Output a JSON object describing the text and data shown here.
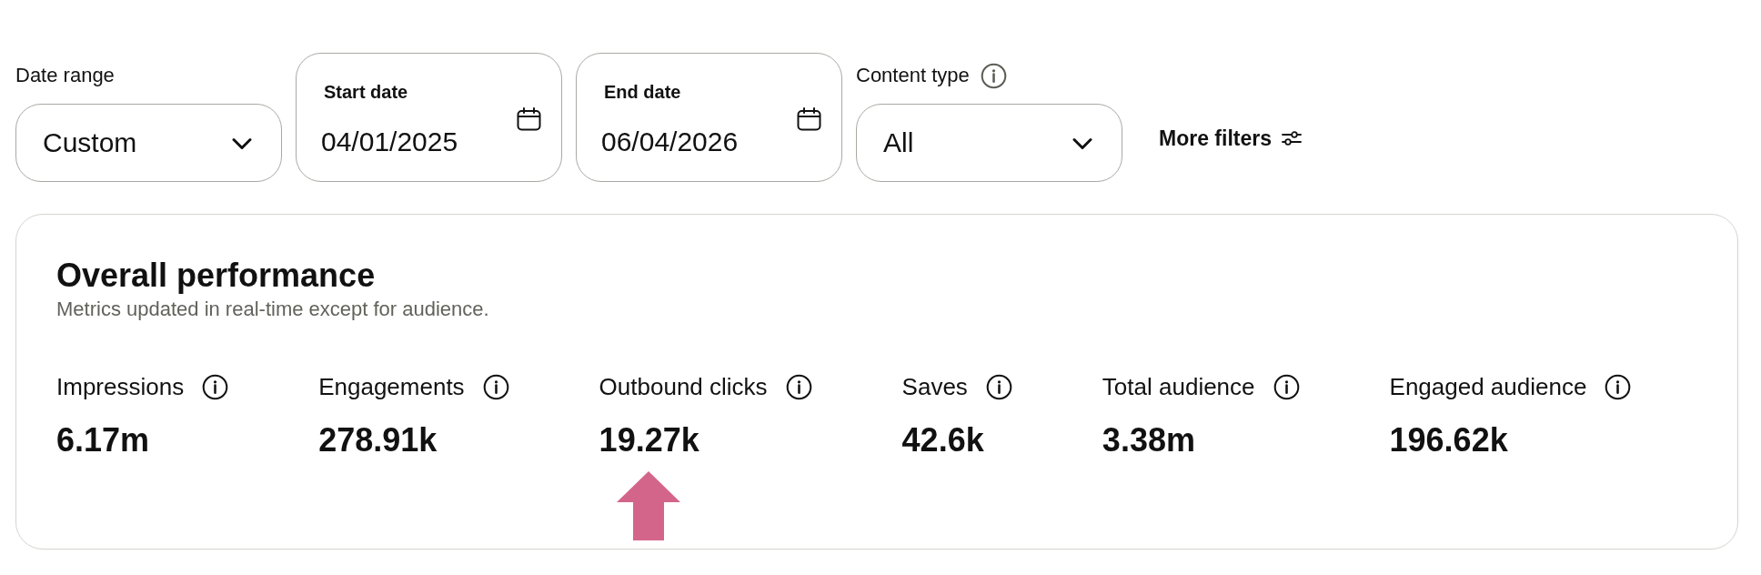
{
  "filters": [
    {
      "kind": "dropdown",
      "label": "Date range",
      "value": "Custom",
      "info": false
    },
    {
      "kind": "date",
      "label": "Start date",
      "value": "04/01/2025"
    },
    {
      "kind": "date",
      "label": "End date",
      "value": "06/04/2026"
    },
    {
      "kind": "dropdown",
      "label": "Content type",
      "value": "All",
      "info": true
    },
    {
      "kind": "button",
      "label": "More filters"
    }
  ],
  "performance": {
    "title": "Overall performance",
    "subtitle": "Metrics updated in real-time except for audience.",
    "metrics": [
      {
        "label": "Impressions",
        "value": "6.17m",
        "marked": false
      },
      {
        "label": "Engagements",
        "value": "278.91k",
        "marked": false
      },
      {
        "label": "Outbound clicks",
        "value": "19.27k",
        "marked": true
      },
      {
        "label": "Saves",
        "value": "42.6k",
        "marked": false
      },
      {
        "label": "Total audience",
        "value": "3.38m",
        "marked": false
      },
      {
        "label": "Engaged audience",
        "value": "196.62k",
        "marked": false
      }
    ]
  }
}
